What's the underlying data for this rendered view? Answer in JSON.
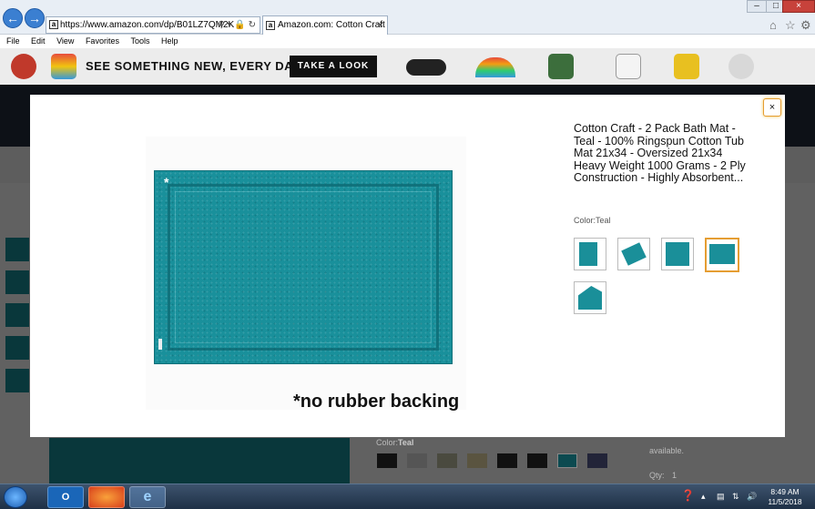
{
  "browser": {
    "address_url": "https://www.amazon.com/dp/B01LZ7QM2K",
    "tab_title": "Amazon.com: Cotton Craft ...",
    "menu": [
      "File",
      "Edit",
      "View",
      "Favorites",
      "Tools",
      "Help"
    ]
  },
  "promo": {
    "text": "SEE SOMETHING NEW, EVERY DAY.",
    "button": "TAKE A LOOK"
  },
  "modal": {
    "close_label": "×",
    "product_title": "Cotton Craft - 2 Pack Bath Mat - Teal - 100% Ringspun Cotton Tub Mat 21x34 - Oversized 21x34 Heavy Weight 1000 Grams - 2 Ply Construction - Highly Absorbent...",
    "color_label": "Color:",
    "color_value": "Teal",
    "image_star": "*",
    "image_caption": "*no rubber backing",
    "selected_thumbnail_index": 3,
    "thumbnail_count": 5
  },
  "background_page": {
    "color_label": "Color:",
    "color_value": "Teal",
    "qty_label": "Qty:",
    "qty_value": "1",
    "fulfilled_text": "available."
  },
  "taskbar": {
    "time": "8:49 AM",
    "date": "11/5/2018"
  },
  "colors": {
    "teal": "#19909b",
    "amazon_dark": "#232f3e",
    "selected_border": "#e59d32"
  }
}
